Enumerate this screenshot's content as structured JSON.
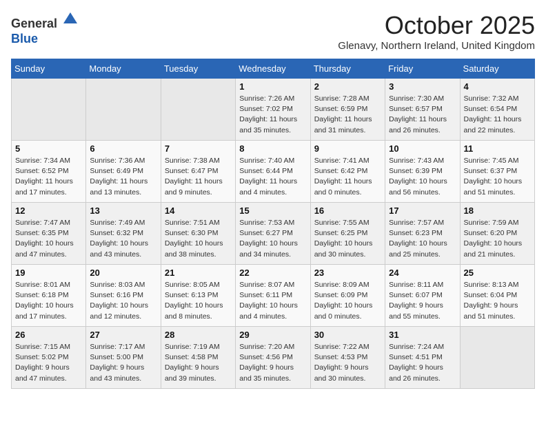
{
  "header": {
    "logo_general": "General",
    "logo_blue": "Blue",
    "month_title": "October 2025",
    "subtitle": "Glenavy, Northern Ireland, United Kingdom"
  },
  "weekdays": [
    "Sunday",
    "Monday",
    "Tuesday",
    "Wednesday",
    "Thursday",
    "Friday",
    "Saturday"
  ],
  "weeks": [
    [
      {
        "day": "",
        "info": ""
      },
      {
        "day": "",
        "info": ""
      },
      {
        "day": "",
        "info": ""
      },
      {
        "day": "1",
        "info": "Sunrise: 7:26 AM\nSunset: 7:02 PM\nDaylight: 11 hours\nand 35 minutes."
      },
      {
        "day": "2",
        "info": "Sunrise: 7:28 AM\nSunset: 6:59 PM\nDaylight: 11 hours\nand 31 minutes."
      },
      {
        "day": "3",
        "info": "Sunrise: 7:30 AM\nSunset: 6:57 PM\nDaylight: 11 hours\nand 26 minutes."
      },
      {
        "day": "4",
        "info": "Sunrise: 7:32 AM\nSunset: 6:54 PM\nDaylight: 11 hours\nand 22 minutes."
      }
    ],
    [
      {
        "day": "5",
        "info": "Sunrise: 7:34 AM\nSunset: 6:52 PM\nDaylight: 11 hours\nand 17 minutes."
      },
      {
        "day": "6",
        "info": "Sunrise: 7:36 AM\nSunset: 6:49 PM\nDaylight: 11 hours\nand 13 minutes."
      },
      {
        "day": "7",
        "info": "Sunrise: 7:38 AM\nSunset: 6:47 PM\nDaylight: 11 hours\nand 9 minutes."
      },
      {
        "day": "8",
        "info": "Sunrise: 7:40 AM\nSunset: 6:44 PM\nDaylight: 11 hours\nand 4 minutes."
      },
      {
        "day": "9",
        "info": "Sunrise: 7:41 AM\nSunset: 6:42 PM\nDaylight: 11 hours\nand 0 minutes."
      },
      {
        "day": "10",
        "info": "Sunrise: 7:43 AM\nSunset: 6:39 PM\nDaylight: 10 hours\nand 56 minutes."
      },
      {
        "day": "11",
        "info": "Sunrise: 7:45 AM\nSunset: 6:37 PM\nDaylight: 10 hours\nand 51 minutes."
      }
    ],
    [
      {
        "day": "12",
        "info": "Sunrise: 7:47 AM\nSunset: 6:35 PM\nDaylight: 10 hours\nand 47 minutes."
      },
      {
        "day": "13",
        "info": "Sunrise: 7:49 AM\nSunset: 6:32 PM\nDaylight: 10 hours\nand 43 minutes."
      },
      {
        "day": "14",
        "info": "Sunrise: 7:51 AM\nSunset: 6:30 PM\nDaylight: 10 hours\nand 38 minutes."
      },
      {
        "day": "15",
        "info": "Sunrise: 7:53 AM\nSunset: 6:27 PM\nDaylight: 10 hours\nand 34 minutes."
      },
      {
        "day": "16",
        "info": "Sunrise: 7:55 AM\nSunset: 6:25 PM\nDaylight: 10 hours\nand 30 minutes."
      },
      {
        "day": "17",
        "info": "Sunrise: 7:57 AM\nSunset: 6:23 PM\nDaylight: 10 hours\nand 25 minutes."
      },
      {
        "day": "18",
        "info": "Sunrise: 7:59 AM\nSunset: 6:20 PM\nDaylight: 10 hours\nand 21 minutes."
      }
    ],
    [
      {
        "day": "19",
        "info": "Sunrise: 8:01 AM\nSunset: 6:18 PM\nDaylight: 10 hours\nand 17 minutes."
      },
      {
        "day": "20",
        "info": "Sunrise: 8:03 AM\nSunset: 6:16 PM\nDaylight: 10 hours\nand 12 minutes."
      },
      {
        "day": "21",
        "info": "Sunrise: 8:05 AM\nSunset: 6:13 PM\nDaylight: 10 hours\nand 8 minutes."
      },
      {
        "day": "22",
        "info": "Sunrise: 8:07 AM\nSunset: 6:11 PM\nDaylight: 10 hours\nand 4 minutes."
      },
      {
        "day": "23",
        "info": "Sunrise: 8:09 AM\nSunset: 6:09 PM\nDaylight: 10 hours\nand 0 minutes."
      },
      {
        "day": "24",
        "info": "Sunrise: 8:11 AM\nSunset: 6:07 PM\nDaylight: 9 hours\nand 55 minutes."
      },
      {
        "day": "25",
        "info": "Sunrise: 8:13 AM\nSunset: 6:04 PM\nDaylight: 9 hours\nand 51 minutes."
      }
    ],
    [
      {
        "day": "26",
        "info": "Sunrise: 7:15 AM\nSunset: 5:02 PM\nDaylight: 9 hours\nand 47 minutes."
      },
      {
        "day": "27",
        "info": "Sunrise: 7:17 AM\nSunset: 5:00 PM\nDaylight: 9 hours\nand 43 minutes."
      },
      {
        "day": "28",
        "info": "Sunrise: 7:19 AM\nSunset: 4:58 PM\nDaylight: 9 hours\nand 39 minutes."
      },
      {
        "day": "29",
        "info": "Sunrise: 7:20 AM\nSunset: 4:56 PM\nDaylight: 9 hours\nand 35 minutes."
      },
      {
        "day": "30",
        "info": "Sunrise: 7:22 AM\nSunset: 4:53 PM\nDaylight: 9 hours\nand 30 minutes."
      },
      {
        "day": "31",
        "info": "Sunrise: 7:24 AM\nSunset: 4:51 PM\nDaylight: 9 hours\nand 26 minutes."
      },
      {
        "day": "",
        "info": ""
      }
    ]
  ]
}
